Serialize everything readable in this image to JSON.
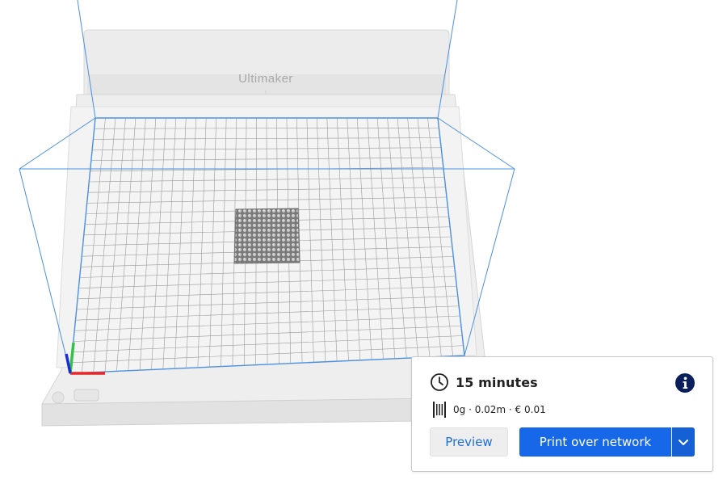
{
  "scene": {
    "printer_brand_label": "Ultimaker",
    "colors": {
      "build_volume_outline": "#4a90e2",
      "grid_line": "#9a9a9a",
      "plate": "#f2f2f2",
      "printer_body": "#ebebeb",
      "model": "#8c8c8c",
      "axis_x": "#e8262a",
      "axis_y": "#33c14a",
      "axis_z": "#1d2bd9"
    },
    "model_name": "model-lattice-cube"
  },
  "print_panel": {
    "estimated_time": "15 minutes",
    "material_usage": "0g · 0.02m · € 0.01",
    "preview_label": "Preview",
    "print_label": "Print over network",
    "icons": {
      "clock": "clock-icon",
      "info": "info-icon",
      "spool": "filament-spool-icon",
      "dropdown": "chevron-down-icon"
    },
    "colors": {
      "accent": "#1668e8",
      "accent_dark": "#1560d4",
      "secondary_bg": "#eeeeee",
      "link_text": "#1e6fd6",
      "info_icon": "#0a1f5c"
    }
  }
}
